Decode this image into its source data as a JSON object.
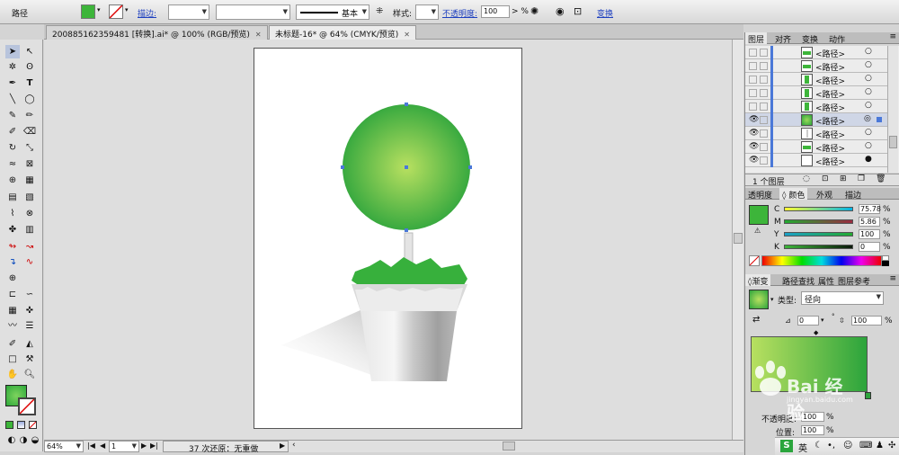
{
  "control_bar": {
    "object_label": "路径",
    "stroke_label": "描边:",
    "profile_label": "基本",
    "style_label": "样式:",
    "opacity_label": "不透明度:",
    "opacity_value": "100",
    "percent": ">  %",
    "transform_label": "变换",
    "fill_color": "#3db53a"
  },
  "tabs": [
    {
      "label": "200885162359481 [转换].ai* @ 100% (RGB/预览)"
    },
    {
      "label": "未标题-16* @ 64% (CMYK/预览)"
    }
  ],
  "status": {
    "zoom": "64%",
    "page": "1",
    "message": "37 次还原：无重做"
  },
  "layers_panel": {
    "tabs": [
      "图层",
      "对齐",
      "变换",
      "动作"
    ],
    "items": [
      "<路径>",
      "<路径>",
      "<路径>",
      "<路径>",
      "<路径>",
      "<路径>",
      "<路径>",
      "<路径>",
      "<路径>"
    ],
    "footer": "1 个图层"
  },
  "color_panel": {
    "tabs": [
      "透明度",
      "颜色",
      "外观",
      "描边"
    ],
    "channels": [
      {
        "label": "C",
        "value": "75.78",
        "unit": "%"
      },
      {
        "label": "M",
        "value": "5.86",
        "unit": "%"
      },
      {
        "label": "Y",
        "value": "100",
        "unit": "%"
      },
      {
        "label": "K",
        "value": "0",
        "unit": "%"
      }
    ]
  },
  "gradient_panel": {
    "tabs": [
      "渐变",
      "路径查找",
      "属性",
      "图层参考"
    ],
    "type_label": "类型:",
    "type_value": "径向",
    "angle_value": "0",
    "ratio_value": "100",
    "opacity_label": "不透明度:",
    "opacity_value": "100",
    "location_label": "位置:",
    "location_value": "100",
    "percent": "%"
  },
  "watermark": {
    "text": "Bai 经验",
    "sub": "jingyan.baidu.com"
  },
  "taskbar": {
    "ime": "英"
  }
}
